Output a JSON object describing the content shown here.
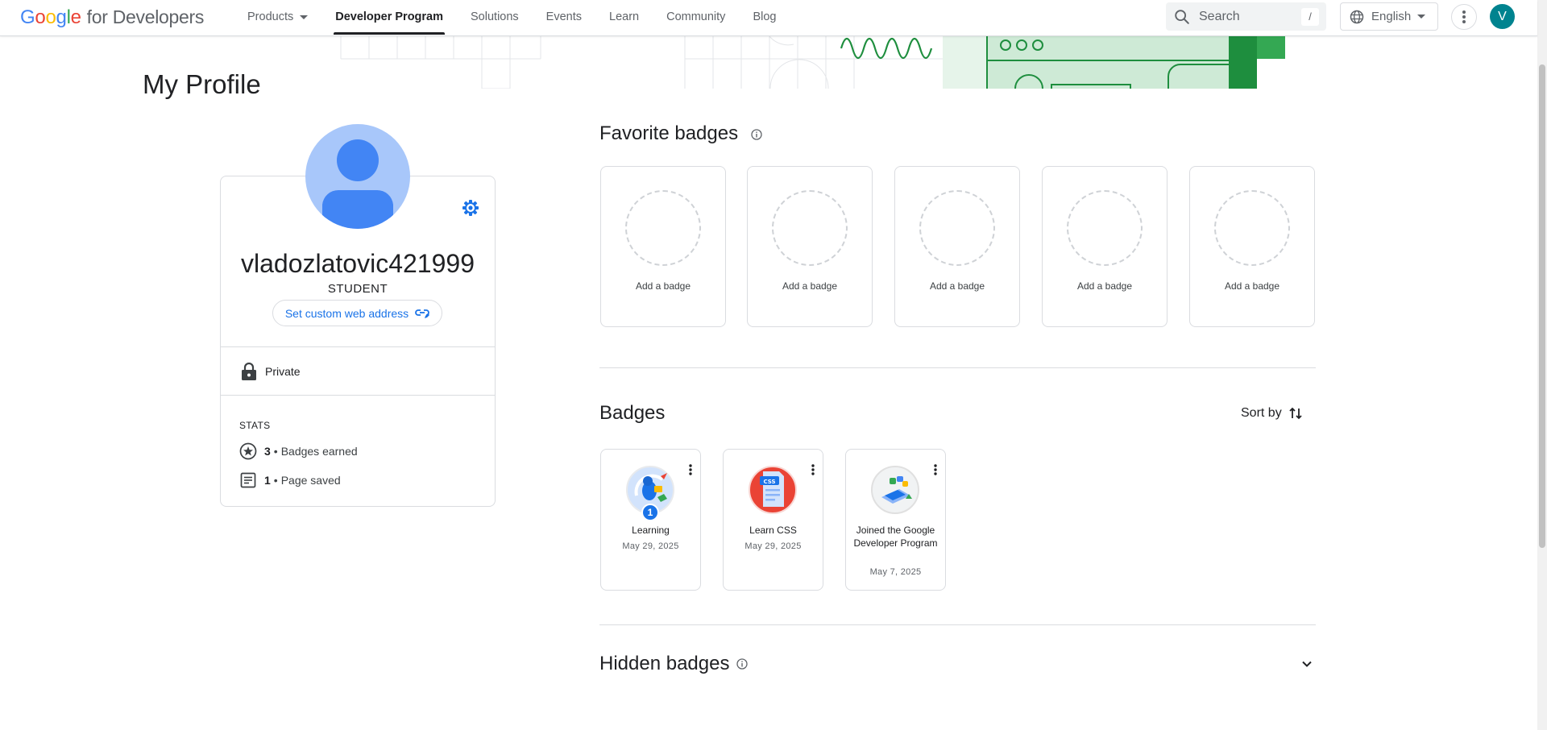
{
  "header": {
    "logo_google": "Google",
    "logo_suffix": "for Developers",
    "nav": [
      {
        "label": "Products",
        "dropdown": true
      },
      {
        "label": "Developer Program",
        "active": true
      },
      {
        "label": "Solutions"
      },
      {
        "label": "Events"
      },
      {
        "label": "Learn"
      },
      {
        "label": "Community"
      },
      {
        "label": "Blog"
      }
    ],
    "search_placeholder": "Search",
    "search_shortcut": "/",
    "language": "English",
    "avatar_initial": "V"
  },
  "page_title": "My Profile",
  "profile": {
    "username": "vladozlatovic421999",
    "role": "STUDENT",
    "custom_address_label": "Set custom web address",
    "visibility": "Private",
    "stats_label": "STATS",
    "stats": [
      {
        "count": "3",
        "label": "Badges earned",
        "icon": "star-badge-icon"
      },
      {
        "count": "1",
        "label": "Page saved",
        "icon": "page-icon"
      }
    ]
  },
  "favorite_badges": {
    "title": "Favorite badges",
    "slots": [
      "Add a badge",
      "Add a badge",
      "Add a badge",
      "Add a badge",
      "Add a badge"
    ]
  },
  "badges": {
    "title": "Badges",
    "sort_label": "Sort by",
    "items": [
      {
        "name": "Learning",
        "date": "May 29, 2025",
        "count": "1"
      },
      {
        "name": "Learn CSS",
        "date": "May 29, 2025",
        "icon_text": "CSS"
      },
      {
        "name": "Joined the Google Developer Program",
        "date": "May 7, 2025"
      }
    ]
  },
  "hidden_badges": {
    "title": "Hidden badges"
  },
  "colors": {
    "accent": "#1a73e8",
    "avatar_bg": "#00838f",
    "profile_avatar_bg": "#a8c7fa",
    "banner_green": "#1e8e3e"
  }
}
